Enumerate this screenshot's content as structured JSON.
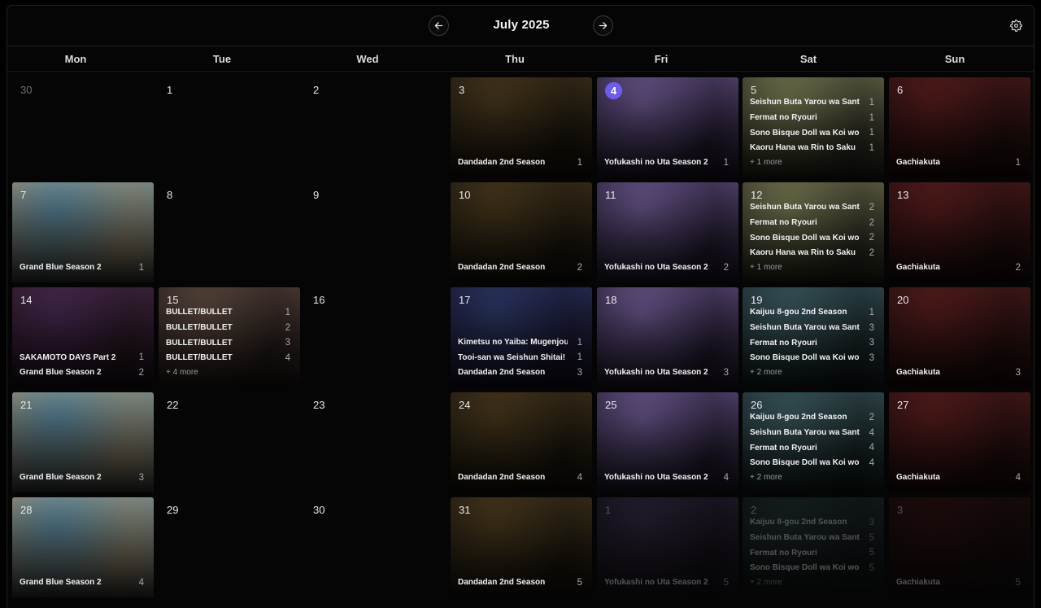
{
  "header": {
    "month": "July 2025"
  },
  "weekdays": [
    "Mon",
    "Tue",
    "Wed",
    "Thu",
    "Fri",
    "Sat",
    "Sun"
  ],
  "art": {
    "dandadan": [
      "#4b3a1e",
      "#1f1a10"
    ],
    "yofukashi": [
      "#6f5b94",
      "#2a2038"
    ],
    "seishun": [
      "#7a7b52",
      "#35352a"
    ],
    "gachiakuta": [
      "#5a1d1d",
      "#261010"
    ],
    "grandblue": [
      "#5c8aa0",
      "#9e8d6e"
    ],
    "sakamoto": [
      "#4a2a55",
      "#2b1a22"
    ],
    "bullet": [
      "#5e4a40",
      "#2c2220"
    ],
    "kimetsu": [
      "#2e3a6a",
      "#1a1630"
    ],
    "kaiju": [
      "#3c5c62",
      "#1c2a2c"
    ]
  },
  "weeks": [
    [
      {
        "day": "30",
        "muted": true
      },
      {
        "day": "1"
      },
      {
        "day": "2"
      },
      {
        "day": "3",
        "bg": "dandadan",
        "episodes": [
          {
            "title": "Dandadan 2nd Season",
            "ep": "1"
          }
        ]
      },
      {
        "day": "4",
        "today": true,
        "bg": "yofukashi",
        "episodes": [
          {
            "title": "Yofukashi no Uta Season 2",
            "ep": "1"
          }
        ]
      },
      {
        "day": "5",
        "bg": "seishun",
        "episodes": [
          {
            "title": "Seishun Buta Yarou wa Santa Claus",
            "ep": "1"
          },
          {
            "title": "Fermat no Ryouri",
            "ep": "1"
          },
          {
            "title": "Sono Bisque Doll wa Koi wo Suru",
            "ep": "1"
          },
          {
            "title": "Kaoru Hana wa Rin to Saku",
            "ep": "1"
          }
        ],
        "more": "+ 1 more"
      },
      {
        "day": "6",
        "bg": "gachiakuta",
        "episodes": [
          {
            "title": "Gachiakuta",
            "ep": "1"
          }
        ]
      }
    ],
    [
      {
        "day": "7",
        "bg": "grandblue",
        "episodes": [
          {
            "title": "Grand Blue Season 2",
            "ep": "1"
          }
        ]
      },
      {
        "day": "8"
      },
      {
        "day": "9"
      },
      {
        "day": "10",
        "bg": "dandadan",
        "episodes": [
          {
            "title": "Dandadan 2nd Season",
            "ep": "2"
          }
        ]
      },
      {
        "day": "11",
        "bg": "yofukashi",
        "episodes": [
          {
            "title": "Yofukashi no Uta Season 2",
            "ep": "2"
          }
        ]
      },
      {
        "day": "12",
        "bg": "seishun",
        "episodes": [
          {
            "title": "Seishun Buta Yarou wa Santa Claus",
            "ep": "2"
          },
          {
            "title": "Fermat no Ryouri",
            "ep": "2"
          },
          {
            "title": "Sono Bisque Doll wa Koi wo Suru",
            "ep": "2"
          },
          {
            "title": "Kaoru Hana wa Rin to Saku",
            "ep": "2"
          }
        ],
        "more": "+ 1 more"
      },
      {
        "day": "13",
        "bg": "gachiakuta",
        "episodes": [
          {
            "title": "Gachiakuta",
            "ep": "2"
          }
        ]
      }
    ],
    [
      {
        "day": "14",
        "bg": "sakamoto",
        "episodes": [
          {
            "title": "SAKAMOTO DAYS Part 2",
            "ep": "1"
          },
          {
            "title": "Grand Blue Season 2",
            "ep": "2"
          }
        ]
      },
      {
        "day": "15",
        "bg": "bullet",
        "episodes": [
          {
            "title": "BULLET/BULLET",
            "ep": "1"
          },
          {
            "title": "BULLET/BULLET",
            "ep": "2"
          },
          {
            "title": "BULLET/BULLET",
            "ep": "3"
          },
          {
            "title": "BULLET/BULLET",
            "ep": "4"
          }
        ],
        "more": "+ 4 more"
      },
      {
        "day": "16"
      },
      {
        "day": "17",
        "bg": "kimetsu",
        "episodes": [
          {
            "title": "Kimetsu no Yaiba: Mugenjou-hen",
            "ep": "1"
          },
          {
            "title": "Tooi-san wa Seishun Shitai! \"Ba",
            "ep": "1"
          },
          {
            "title": "Dandadan 2nd Season",
            "ep": "3"
          }
        ]
      },
      {
        "day": "18",
        "bg": "yofukashi",
        "episodes": [
          {
            "title": "Yofukashi no Uta Season 2",
            "ep": "3"
          }
        ]
      },
      {
        "day": "19",
        "bg": "kaiju",
        "episodes": [
          {
            "title": "Kaijuu 8-gou 2nd Season",
            "ep": "1"
          },
          {
            "title": "Seishun Buta Yarou wa Santa Claus",
            "ep": "3"
          },
          {
            "title": "Fermat no Ryouri",
            "ep": "3"
          },
          {
            "title": "Sono Bisque Doll wa Koi wo Suru",
            "ep": "3"
          }
        ],
        "more": "+ 2 more"
      },
      {
        "day": "20",
        "bg": "gachiakuta",
        "episodes": [
          {
            "title": "Gachiakuta",
            "ep": "3"
          }
        ]
      }
    ],
    [
      {
        "day": "21",
        "bg": "grandblue",
        "episodes": [
          {
            "title": "Grand Blue Season 2",
            "ep": "3"
          }
        ]
      },
      {
        "day": "22"
      },
      {
        "day": "23"
      },
      {
        "day": "24",
        "bg": "dandadan",
        "episodes": [
          {
            "title": "Dandadan 2nd Season",
            "ep": "4"
          }
        ]
      },
      {
        "day": "25",
        "bg": "yofukashi",
        "episodes": [
          {
            "title": "Yofukashi no Uta Season 2",
            "ep": "4"
          }
        ]
      },
      {
        "day": "26",
        "bg": "kaiju",
        "episodes": [
          {
            "title": "Kaijuu 8-gou 2nd Season",
            "ep": "2"
          },
          {
            "title": "Seishun Buta Yarou wa Santa Claus",
            "ep": "4"
          },
          {
            "title": "Fermat no Ryouri",
            "ep": "4"
          },
          {
            "title": "Sono Bisque Doll wa Koi wo Suru",
            "ep": "4"
          }
        ],
        "more": "+ 2 more"
      },
      {
        "day": "27",
        "bg": "gachiakuta",
        "episodes": [
          {
            "title": "Gachiakuta",
            "ep": "4"
          }
        ]
      }
    ],
    [
      {
        "day": "28",
        "bg": "grandblue",
        "episodes": [
          {
            "title": "Grand Blue Season 2",
            "ep": "4"
          }
        ]
      },
      {
        "day": "29"
      },
      {
        "day": "30"
      },
      {
        "day": "31",
        "bg": "dandadan",
        "episodes": [
          {
            "title": "Dandadan 2nd Season",
            "ep": "5"
          }
        ]
      },
      {
        "day": "1",
        "dim": true,
        "bg": "yofukashi",
        "episodes": [
          {
            "title": "Yofukashi no Uta Season 2",
            "ep": "5"
          }
        ]
      },
      {
        "day": "2",
        "dim": true,
        "bg": "kaiju",
        "episodes": [
          {
            "title": "Kaijuu 8-gou 2nd Season",
            "ep": "3"
          },
          {
            "title": "Seishun Buta Yarou wa Santa Claus",
            "ep": "5"
          },
          {
            "title": "Fermat no Ryouri",
            "ep": "5"
          },
          {
            "title": "Sono Bisque Doll wa Koi wo Suru",
            "ep": "5"
          }
        ],
        "more": "+ 2 more"
      },
      {
        "day": "3",
        "dim": true,
        "bg": "gachiakuta",
        "episodes": [
          {
            "title": "Gachiakuta",
            "ep": "5"
          }
        ]
      }
    ]
  ]
}
